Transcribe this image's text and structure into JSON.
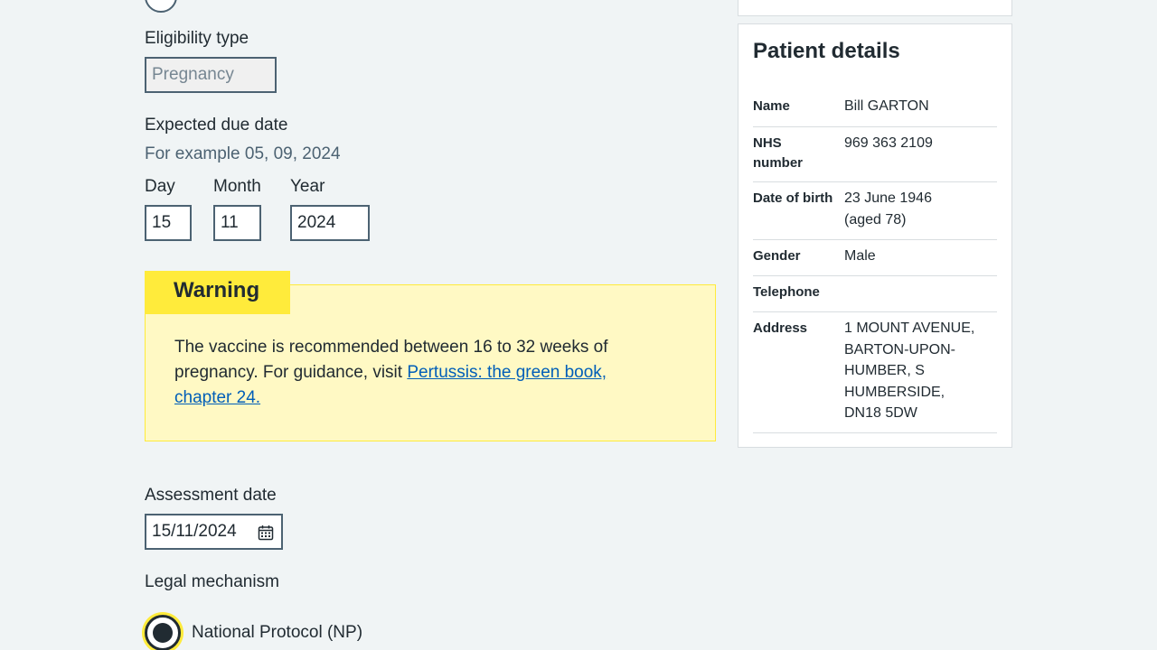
{
  "form": {
    "eligibility_label": "Eligibility type",
    "eligibility_value": "Pregnancy",
    "due_date_label": "Expected due date",
    "due_date_hint": "For example 05, 09, 2024",
    "day_label": "Day",
    "day_value": "15",
    "month_label": "Month",
    "month_value": "11",
    "year_label": "Year",
    "year_value": "2024",
    "assessment_label": "Assessment date",
    "assessment_value": "15/11/2024",
    "legal_label": "Legal mechanism",
    "np_label": "National Protocol (NP)"
  },
  "warning": {
    "heading": "Warning",
    "text": "The vaccine is recommended between 16 to 32 weeks of pregnancy. For guidance, visit ",
    "link": "Pertussis: the green book, chapter 24."
  },
  "patient": {
    "title": "Patient details",
    "name_key": "Name",
    "name_val": "Bill GARTON",
    "nhs_key": "NHS number",
    "nhs_val": "969 363 2109",
    "dob_key": "Date of birth",
    "dob_val": "23 June 1946 (aged 78)",
    "gender_key": "Gender",
    "gender_val": "Male",
    "telephone_key": "Telephone",
    "telephone_val": "",
    "address_key": "Address",
    "address_val": "1 MOUNT AVENUE, BARTON-UPON-HUMBER, S HUMBERSIDE, DN18 5DW"
  },
  "colors": {
    "background": "#f0f4f5",
    "warning_bg": "#fff9c4",
    "warning_accent": "#ffeb3b",
    "link": "#005eb8",
    "text": "#212b32"
  }
}
